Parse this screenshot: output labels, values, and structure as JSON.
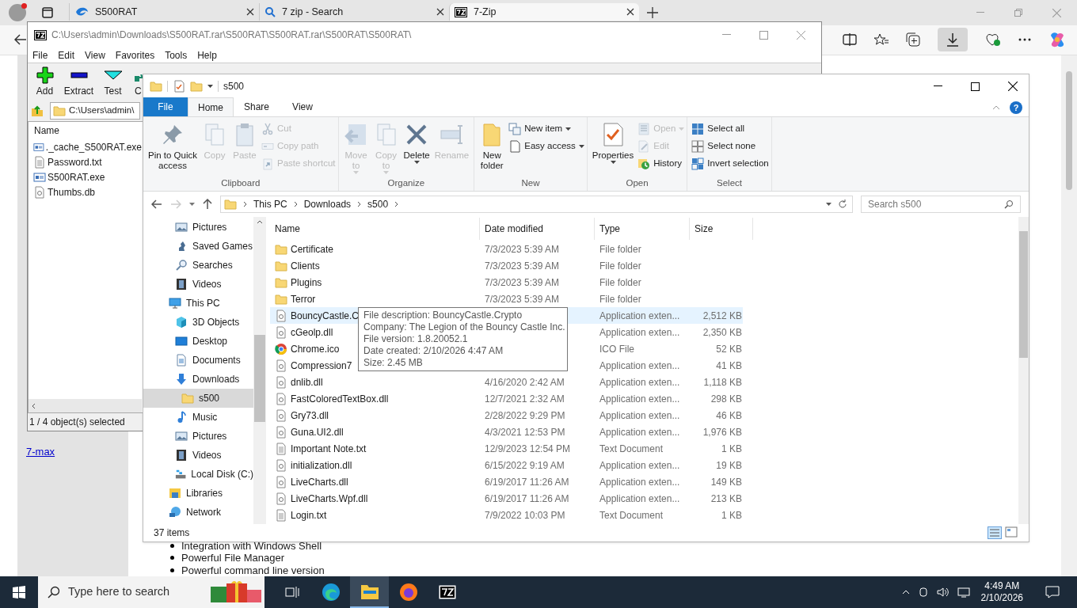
{
  "browser": {
    "tabs": [
      {
        "title": "S500RAT",
        "kind": "site",
        "selected": false
      },
      {
        "title": "7 zip - Search",
        "kind": "search",
        "selected": false
      },
      {
        "title": "7-Zip",
        "kind": "sevenzip",
        "selected": true
      }
    ],
    "page": {
      "link": "7-max",
      "bullets": [
        "Integration with Windows Shell",
        "Powerful File Manager",
        "Powerful command line version"
      ]
    }
  },
  "sevenzip": {
    "title": "C:\\Users\\admin\\Downloads\\S500RAT.rar\\S500RAT\\S500RAT.rar\\S500RAT\\S500RAT\\",
    "menu": [
      "File",
      "Edit",
      "View",
      "Favorites",
      "Tools",
      "Help"
    ],
    "toolbar": [
      {
        "label": "Add",
        "kind": "add"
      },
      {
        "label": "Extract",
        "kind": "extract"
      },
      {
        "label": "Test",
        "kind": "test"
      },
      {
        "label": "C",
        "kind": "copy"
      }
    ],
    "address": "C:\\Users\\admin\\",
    "column": "Name",
    "files": [
      {
        "name": "._cache_S500RAT.exe",
        "kind": "exe"
      },
      {
        "name": "Password.txt",
        "kind": "txt"
      },
      {
        "name": "S500RAT.exe",
        "kind": "exe"
      },
      {
        "name": "Thumbs.db",
        "kind": "db"
      }
    ],
    "status": "1 / 4 object(s) selected"
  },
  "explorer": {
    "title": "s500",
    "file_menu": "File",
    "tabs": [
      {
        "label": "Home",
        "selected": true
      },
      {
        "label": "Share",
        "selected": false
      },
      {
        "label": "View",
        "selected": false
      }
    ],
    "help": "?",
    "groups": [
      {
        "label": "Clipboard",
        "items": [
          {
            "lines": [
              "Pin to Quick",
              "access"
            ],
            "kind": "pin",
            "large": true,
            "disabled": false,
            "dropdown": false
          },
          {
            "lines": [
              "Copy"
            ],
            "kind": "copy",
            "large": true,
            "disabled": true,
            "dropdown": false
          },
          {
            "lines": [
              "Paste"
            ],
            "kind": "paste",
            "large": true,
            "disabled": true,
            "dropdown": false
          },
          {
            "label": "Cut",
            "kind": "cut",
            "large": false,
            "disabled": true,
            "dropdown": false
          },
          {
            "label": "Copy path",
            "kind": "path",
            "large": false,
            "disabled": true,
            "dropdown": false
          },
          {
            "label": "Paste shortcut",
            "kind": "shortcut",
            "large": false,
            "disabled": true,
            "dropdown": false
          }
        ]
      },
      {
        "label": "Organize",
        "items": [
          {
            "lines": [
              "Move",
              "to"
            ],
            "kind": "move",
            "large": true,
            "disabled": true,
            "dropdown": true
          },
          {
            "lines": [
              "Copy",
              "to"
            ],
            "kind": "copy",
            "large": true,
            "disabled": true,
            "dropdown": true
          },
          {
            "lines": [
              "Delete"
            ],
            "kind": "delete",
            "large": true,
            "disabled": false,
            "dropdown": true
          },
          {
            "lines": [
              "Rename"
            ],
            "kind": "rename",
            "large": true,
            "disabled": true,
            "dropdown": false
          }
        ]
      },
      {
        "label": "New",
        "items": [
          {
            "lines": [
              "New",
              "folder"
            ],
            "kind": "folder",
            "large": true,
            "disabled": false,
            "dropdown": false
          },
          {
            "label": "New item",
            "kind": "newitem",
            "large": false,
            "disabled": false,
            "dropdown": true
          },
          {
            "label": "Easy access",
            "kind": "easy",
            "large": false,
            "disabled": false,
            "dropdown": true
          }
        ]
      },
      {
        "label": "Open",
        "items": [
          {
            "lines": [
              "Properties"
            ],
            "kind": "properties",
            "large": true,
            "disabled": false,
            "dropdown": true
          },
          {
            "label": "Open",
            "kind": "open",
            "large": false,
            "disabled": true,
            "dropdown": true
          },
          {
            "label": "Edit",
            "kind": "edit",
            "large": false,
            "disabled": true,
            "dropdown": false
          },
          {
            "label": "History",
            "kind": "history",
            "large": false,
            "disabled": false,
            "dropdown": false
          }
        ]
      },
      {
        "label": "Select",
        "items": [
          {
            "label": "Select all",
            "kind": "selectall",
            "large": false,
            "disabled": false,
            "dropdown": false
          },
          {
            "label": "Select none",
            "kind": "selectnone",
            "large": false,
            "disabled": false,
            "dropdown": false
          },
          {
            "label": "Invert selection",
            "kind": "invert",
            "large": false,
            "disabled": false,
            "dropdown": false
          }
        ]
      }
    ],
    "breadcrumb": [
      "This PC",
      "Downloads",
      "s500"
    ],
    "search": {
      "placeholder": "Search s500"
    },
    "nav": [
      {
        "children": [
          {
            "label": "Pictures",
            "kind": "pictures",
            "selected": false
          },
          {
            "label": "Saved Games",
            "kind": "games",
            "selected": false
          },
          {
            "label": "Searches",
            "kind": "searches",
            "selected": false
          },
          {
            "label": "Videos",
            "kind": "videos",
            "selected": false
          }
        ]
      },
      {
        "label": "This PC",
        "kind": "pc",
        "selected": false,
        "children": [
          {
            "label": "3D Objects",
            "kind": "objects",
            "selected": false
          },
          {
            "label": "Desktop",
            "kind": "desktop",
            "selected": false
          },
          {
            "label": "Documents",
            "kind": "documents",
            "selected": false
          },
          {
            "label": "Downloads",
            "kind": "downloads",
            "selected": false,
            "children": [
              {
                "label": "s500",
                "kind": "folder",
                "selected": true
              }
            ]
          },
          {
            "label": "Music",
            "kind": "music",
            "selected": false
          },
          {
            "label": "Pictures",
            "kind": "pictures",
            "selected": false
          },
          {
            "label": "Videos",
            "kind": "videos",
            "selected": false
          },
          {
            "label": "Local Disk (C:)",
            "kind": "disk",
            "selected": false
          }
        ]
      },
      {
        "label": "Libraries",
        "kind": "libraries",
        "selected": false
      },
      {
        "label": "Network",
        "kind": "network",
        "selected": false
      }
    ],
    "columns": [
      "Name",
      "Date modified",
      "Type",
      "Size"
    ],
    "files": [
      {
        "name": "Certificate",
        "kind": "folder",
        "date": "7/3/2023 5:39 AM",
        "type": "File folder",
        "hovered": false
      },
      {
        "name": "Clients",
        "kind": "folder",
        "date": "7/3/2023 5:39 AM",
        "type": "File folder",
        "hovered": false
      },
      {
        "name": "Plugins",
        "kind": "folder",
        "date": "7/3/2023 5:39 AM",
        "type": "File folder",
        "hovered": false
      },
      {
        "name": "Terror",
        "kind": "folder",
        "date": "7/3/2023 5:39 AM",
        "type": "File folder",
        "hovered": false
      },
      {
        "name": "BouncyCastle.C",
        "kind": "dll",
        "type": "Application exten...",
        "size": "2,512 KB",
        "hovered": true
      },
      {
        "name": "cGeolp.dll",
        "kind": "dll",
        "type": "Application exten...",
        "size": "2,350 KB",
        "hovered": false
      },
      {
        "name": "Chrome.ico",
        "kind": "ico",
        "type": "ICO File",
        "size": "52 KB",
        "hovered": false
      },
      {
        "name": "Compression7",
        "kind": "dll",
        "type": "Application exten...",
        "size": "41 KB",
        "hovered": false
      },
      {
        "name": "dnlib.dll",
        "kind": "dll",
        "date": "4/16/2020 2:42 AM",
        "type": "Application exten...",
        "size": "1,118 KB",
        "hovered": false
      },
      {
        "name": "FastColoredTextBox.dll",
        "kind": "dll",
        "date": "12/7/2021 2:32 AM",
        "type": "Application exten...",
        "size": "298 KB",
        "hovered": false
      },
      {
        "name": "Gry73.dll",
        "kind": "dll",
        "date": "2/28/2022 9:29 PM",
        "type": "Application exten...",
        "size": "46 KB",
        "hovered": false
      },
      {
        "name": "Guna.UI2.dll",
        "kind": "dll",
        "date": "4/3/2021 12:53 PM",
        "type": "Application exten...",
        "size": "1,976 KB",
        "hovered": false
      },
      {
        "name": "Important Note.txt",
        "kind": "txt",
        "date": "12/9/2023 12:54 PM",
        "type": "Text Document",
        "size": "1 KB",
        "hovered": false
      },
      {
        "name": "initialization.dll",
        "kind": "dll",
        "date": "6/15/2022 9:19 AM",
        "type": "Application exten...",
        "size": "19 KB",
        "hovered": false
      },
      {
        "name": "LiveCharts.dll",
        "kind": "dll",
        "date": "6/19/2017 11:26 AM",
        "type": "Application exten...",
        "size": "149 KB",
        "hovered": false
      },
      {
        "name": "LiveCharts.Wpf.dll",
        "kind": "dll",
        "date": "6/19/2017 11:26 AM",
        "type": "Application exten...",
        "size": "213 KB",
        "hovered": false
      },
      {
        "name": "Login.txt",
        "kind": "txt",
        "date": "7/9/2022 10:03 PM",
        "type": "Text Document",
        "size": "1 KB",
        "hovered": false
      }
    ],
    "tooltip": [
      "File description: BouncyCastle.Crypto",
      "Company: The Legion of the Bouncy Castle Inc.",
      "File version: 1.8.20052.1",
      "Date created: 2/10/2026 4:47 AM",
      "Size: 2.45 MB"
    ],
    "status": "37 items"
  },
  "taskbar": {
    "search": {
      "placeholder": "Type here to search"
    },
    "apps": [
      {
        "kind": "taskview",
        "active": false
      },
      {
        "kind": "edge",
        "active": false
      },
      {
        "kind": "explorer",
        "active": true
      },
      {
        "kind": "firefox",
        "active": false
      },
      {
        "kind": "sevenzip",
        "active": false
      }
    ],
    "time": "4:49 AM",
    "date": "2/10/2026"
  }
}
